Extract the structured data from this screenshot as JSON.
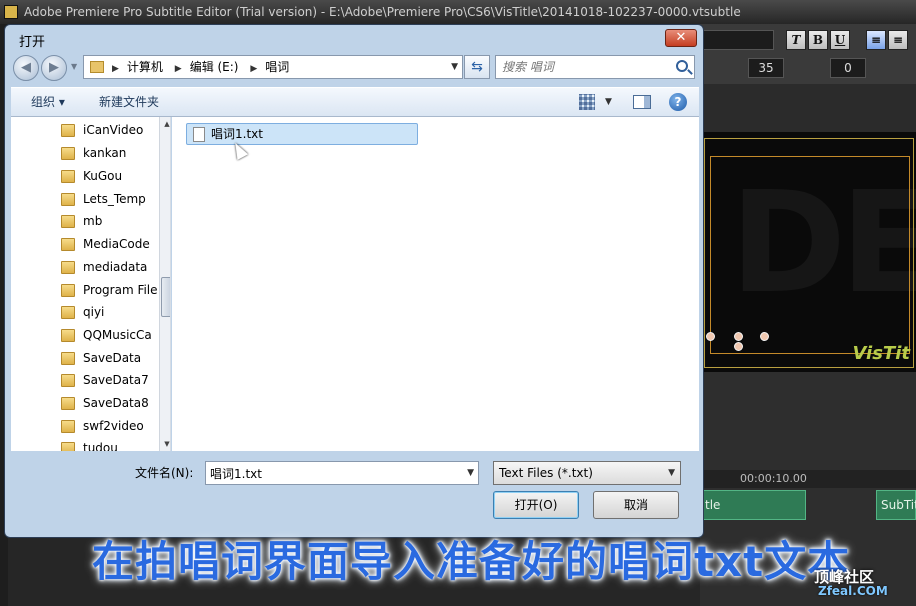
{
  "app": {
    "title": "Adobe Premiere Pro Subtitle Editor (Trial version) - E:\\Adobe\\Premiere Pro\\CS6\\VisTitle\\20141018-102237-0000.vtsubtle",
    "toolbar": {
      "italic": "T",
      "bold": "B",
      "underline": "U",
      "font_size": "35",
      "spacing": "0"
    },
    "canvas_tag": "VisTit",
    "timeline": {
      "timecode": "00:00:10.00",
      "clip1": "tle",
      "clip2": "SubTit"
    }
  },
  "dialog": {
    "title": "打开",
    "close": "✕",
    "breadcrumbs": [
      "计算机",
      "编辑 (E:)",
      "唱词"
    ],
    "search_placeholder": "搜索 唱词",
    "organize": "组织 ▾",
    "new_folder": "新建文件夹",
    "help": "?",
    "folders": [
      {
        "label": "iCanVideo"
      },
      {
        "label": "kankan"
      },
      {
        "label": "KuGou"
      },
      {
        "label": "Lets_Temp"
      },
      {
        "label": "mb"
      },
      {
        "label": "MediaCode"
      },
      {
        "label": "mediadata"
      },
      {
        "label": "Program File"
      },
      {
        "label": "qiyi"
      },
      {
        "label": "QQMusicCa"
      },
      {
        "label": "SaveData"
      },
      {
        "label": "SaveData7"
      },
      {
        "label": "SaveData8"
      },
      {
        "label": "swf2video"
      },
      {
        "label": "tudou"
      }
    ],
    "files": [
      {
        "label": "唱词1.txt",
        "selected": true
      }
    ],
    "filename_label": "文件名(N):",
    "filename_value": "唱词1.txt",
    "filetype_value": "Text Files (*.txt)",
    "open_button": "打开(O)",
    "cancel_button": "取消"
  },
  "subtitle_text": "在拍唱词界面导入准备好的唱词txt文本",
  "watermark": {
    "line1": "顶峰社区",
    "line2": "Zfeal.COM"
  }
}
